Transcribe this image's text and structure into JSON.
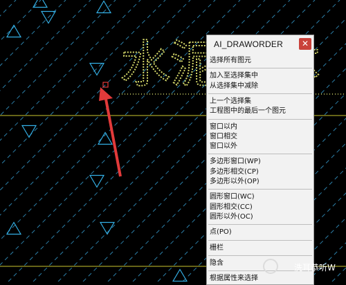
{
  "canvas": {
    "background_text": "水泥墙体",
    "colors": {
      "background": "#000000",
      "hatch": "#2c7fa8",
      "triangle": "#34b0e6",
      "text": "#d6d96a",
      "line": "#a39f26",
      "arrow": "#e23a3a"
    }
  },
  "menu": {
    "title": "AI_DRAWORDER",
    "close_icon": "close-icon",
    "groups": [
      [
        "选择所有图元"
      ],
      [
        "加入至选择集中",
        "从选择集中减除"
      ],
      [
        "上一个选择集",
        "工程图中的最后一个图元"
      ],
      [
        "窗口以内",
        "窗口相交",
        "窗口以外"
      ],
      [
        "多边形窗口(WP)",
        "多边形相交(CP)",
        "多边形以外(OP)"
      ],
      [
        "圆形窗口(WC)",
        "圆形相交(CC)",
        "圆形以外(OC)"
      ],
      [
        "点(PO)"
      ],
      [
        "栅栏"
      ],
      [
        "隐含"
      ],
      [
        "根据属性来选择"
      ]
    ]
  },
  "watermark": {
    "logo": "Baidu经验",
    "author": "洗耳恭听W"
  }
}
